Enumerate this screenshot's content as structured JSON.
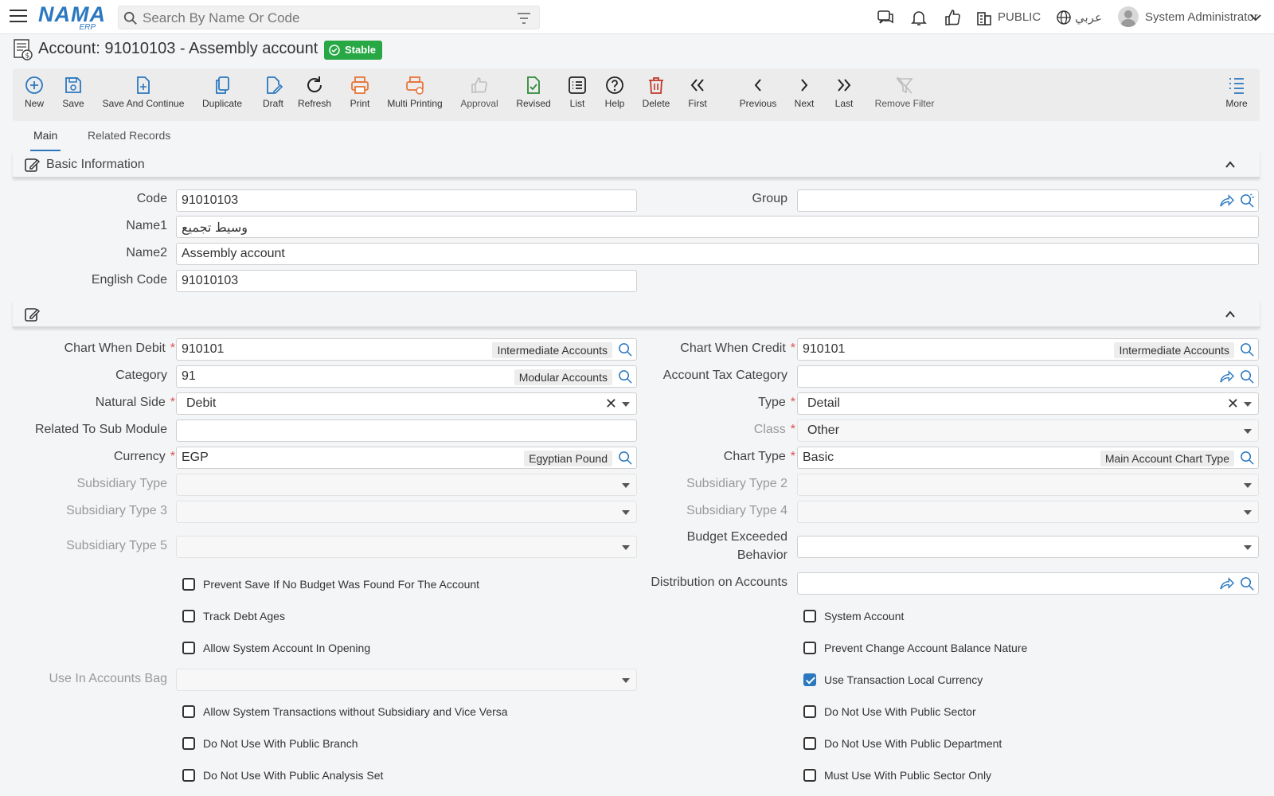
{
  "app": {
    "logo_main": "NAMA",
    "logo_sub": "ERP"
  },
  "search": {
    "placeholder": "Search By Name Or Code"
  },
  "topbar": {
    "public_label": "PUBLIC",
    "language_label": "عربي",
    "user_name": "System Administrator"
  },
  "page": {
    "title": "Account: 91010103 - Assembly account",
    "status": "Stable"
  },
  "toolbar": {
    "new": "New",
    "save": "Save",
    "save_continue": "Save And Continue",
    "duplicate": "Duplicate",
    "draft": "Draft",
    "refresh": "Refresh",
    "print": "Print",
    "multi_printing": "Multi Printing",
    "approval": "Approval",
    "revised": "Revised",
    "list": "List",
    "help": "Help",
    "delete": "Delete",
    "first": "First",
    "previous": "Previous",
    "next": "Next",
    "last": "Last",
    "remove_filter": "Remove Filter",
    "more": "More"
  },
  "tabs": {
    "main": "Main",
    "related": "Related Records"
  },
  "basic": {
    "section_title": "Basic Information",
    "code_label": "Code",
    "code_value": "91010103",
    "group_label": "Group",
    "group_value": "",
    "name1_label": "Name1",
    "name1_value": "وسيط تجميع",
    "name2_label": "Name2",
    "name2_value": "Assembly account",
    "english_code_label": "English Code",
    "english_code_value": "91010103"
  },
  "details": {
    "chart_debit_label": "Chart When Debit",
    "chart_debit_value": "910101",
    "chart_debit_tag": "Intermediate Accounts",
    "chart_credit_label": "Chart When Credit",
    "chart_credit_value": "910101",
    "chart_credit_tag": "Intermediate Accounts",
    "category_label": "Category",
    "category_value": "91",
    "category_tag": "Modular Accounts",
    "tax_category_label": "Account Tax Category",
    "tax_category_value": "",
    "natural_side_label": "Natural Side",
    "natural_side_value": "Debit",
    "type_label": "Type",
    "type_value": "Detail",
    "sub_module_label": "Related To Sub Module",
    "sub_module_value": "",
    "class_label": "Class",
    "class_value": "Other",
    "currency_label": "Currency",
    "currency_value": "EGP",
    "currency_tag": "Egyptian Pound",
    "chart_type_label": "Chart Type",
    "chart_type_value": "Basic",
    "chart_type_tag": "Main Account Chart Type",
    "subsidiary_type_label": "Subsidiary Type",
    "subsidiary_type2_label": "Subsidiary Type 2",
    "subsidiary_type3_label": "Subsidiary Type 3",
    "subsidiary_type4_label": "Subsidiary Type 4",
    "subsidiary_type5_label": "Subsidiary Type 5",
    "budget_exceeded_label": "Budget Exceeded Behavior",
    "distribution_label": "Distribution on Accounts",
    "use_in_bag_label": "Use In Accounts Bag",
    "checks": {
      "prevent_save": "Prevent Save If No Budget Was Found For The Account",
      "track_debt": "Track Debt Ages",
      "allow_system_opening": "Allow System Account In Opening",
      "allow_system_trans": "Allow System Transactions without Subsidiary and Vice Versa",
      "no_public_branch": "Do Not Use With Public Branch",
      "no_public_analysis": "Do Not Use With Public Analysis Set",
      "system_account": "System Account",
      "prevent_change_nature": "Prevent Change Account Balance Nature",
      "use_local_currency": "Use Transaction Local Currency",
      "no_public_sector": "Do Not Use With Public Sector",
      "no_public_department": "Do Not Use With Public Department",
      "must_public_sector": "Must Use With Public Sector Only"
    }
  },
  "colors": {
    "accent": "#2b78c0",
    "badge": "#28a745",
    "icon_orange": "#e8743b",
    "icon_green": "#2e8b3a",
    "icon_red": "#c0392b"
  }
}
